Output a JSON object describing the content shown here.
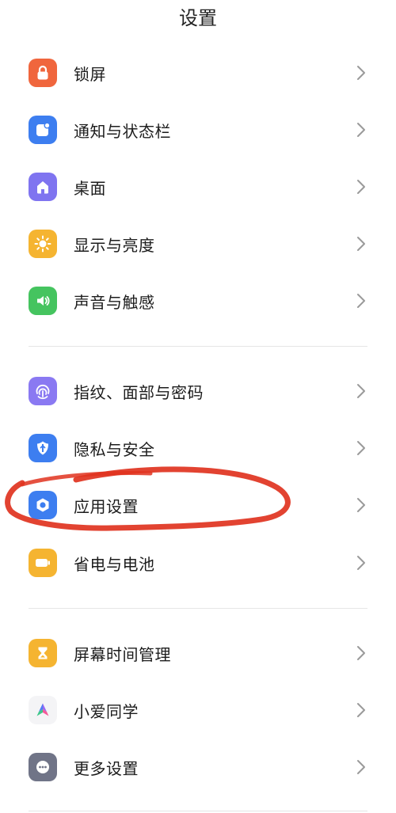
{
  "header": {
    "title": "设置"
  },
  "groups": [
    {
      "items": [
        {
          "label": "锁屏",
          "icon": "lock-icon",
          "color": "#f0663d"
        },
        {
          "label": "通知与状态栏",
          "icon": "notification-icon",
          "color": "#3d7ef0"
        },
        {
          "label": "桌面",
          "icon": "home-icon",
          "color": "#7f74f0"
        },
        {
          "label": "显示与亮度",
          "icon": "sun-icon",
          "color": "#f5b431"
        },
        {
          "label": "声音与触感",
          "icon": "speaker-icon",
          "color": "#45c45f"
        }
      ]
    },
    {
      "items": [
        {
          "label": "指纹、面部与密码",
          "icon": "fingerprint-icon",
          "color": "#8a79f2"
        },
        {
          "label": "隐私与安全",
          "icon": "shield-icon",
          "color": "#3d7ef0"
        },
        {
          "label": "应用设置",
          "icon": "gear-icon",
          "color": "#3d7ef0"
        },
        {
          "label": "省电与电池",
          "icon": "battery-icon",
          "color": "#f5b431"
        }
      ]
    },
    {
      "items": [
        {
          "label": "屏幕时间管理",
          "icon": "hourglass-icon",
          "color": "#f5b431"
        },
        {
          "label": "小爱同学",
          "icon": "xiaoai-icon",
          "color": "#f4f4f6"
        },
        {
          "label": "更多设置",
          "icon": "more-icon",
          "color": "#707487"
        }
      ]
    }
  ],
  "annotation": {
    "color": "#e0331f",
    "circled_item": "应用设置"
  }
}
